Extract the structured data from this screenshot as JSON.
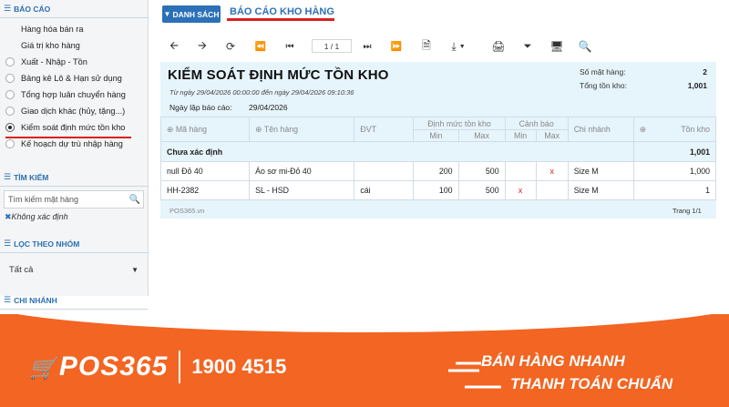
{
  "sidebar": {
    "report_section": "BÁO CÁO",
    "report_items": [
      {
        "label": "Hàng hóa bán ra",
        "selected": false
      },
      {
        "label": "Giá trị kho hàng",
        "selected": false
      },
      {
        "label": "Xuất - Nhập - Tồn",
        "selected": false
      },
      {
        "label": "Bảng kê Lô & Hạn sử dụng",
        "selected": false
      },
      {
        "label": "Tổng hợp luân chuyển hàng",
        "selected": false
      },
      {
        "label": "Giao dịch khác (hủy, tặng...)",
        "selected": false
      },
      {
        "label": "Kiểm soát định mức tồn kho",
        "selected": true
      },
      {
        "label": "Kế hoạch dự trù nhập hàng",
        "selected": false
      }
    ],
    "search_section": "TÌM KIẾM",
    "search_placeholder": "Tìm kiếm mặt hàng",
    "search_tag": "Không xác định",
    "group_section": "LỌC THEO NHÓM",
    "group_value": "Tất cả",
    "branch_section": "CHI NHÁNH"
  },
  "header": {
    "list_button": "DANH SÁCH",
    "report_tab": "BÁO CÁO KHO HÀNG"
  },
  "toolbar": {
    "page_indicator": "1 / 1"
  },
  "report": {
    "title": "KIỂM SOÁT ĐỊNH MỨC TỒN KHO",
    "range": "Từ ngày 29/04/2026 00:00:00 đến ngày 29/04/2026 09:10:36",
    "created_label": "Ngày lập báo cáo:",
    "created_value": "29/04/2026",
    "count_label": "Số mặt hàng:",
    "count_value": "2",
    "total_label": "Tổng tồn kho:",
    "total_value": "1,001",
    "columns": {
      "code": "Mã hàng",
      "name": "Tên hàng",
      "unit": "ĐVT",
      "norm": "Định mức tồn kho",
      "warn": "Cảnh báo",
      "branch": "Chi nhánh",
      "stock": "Tồn kho",
      "min": "Min",
      "max": "Max"
    },
    "group": {
      "label": "Chưa xác định",
      "total": "1,001"
    },
    "rows": [
      {
        "code": "null Đỏ 40",
        "name": "Áo sơ mi-Đỏ 40",
        "unit": "",
        "min": "200",
        "max": "500",
        "warn_min": "",
        "warn_max": "x",
        "branch": "Size M",
        "stock": "1,000"
      },
      {
        "code": "HH-2382",
        "name": "SL - HSD",
        "unit": "cái",
        "min": "100",
        "max": "500",
        "warn_min": "x",
        "warn_max": "",
        "branch": "Size M",
        "stock": "1"
      }
    ],
    "footer_brand": "POS365.vn",
    "footer_page": "Trang 1/1"
  },
  "banner": {
    "logo": "POS365",
    "phone": "1900 4515",
    "slogan_line1": "BÁN HÀNG NHANH",
    "slogan_line2": "THANH TOÁN CHUẨN"
  },
  "colors": {
    "accent_blue": "#2c71b8",
    "underline_red": "#d9201f",
    "banner_orange": "#f26522",
    "report_bg": "#e6f4fb"
  }
}
